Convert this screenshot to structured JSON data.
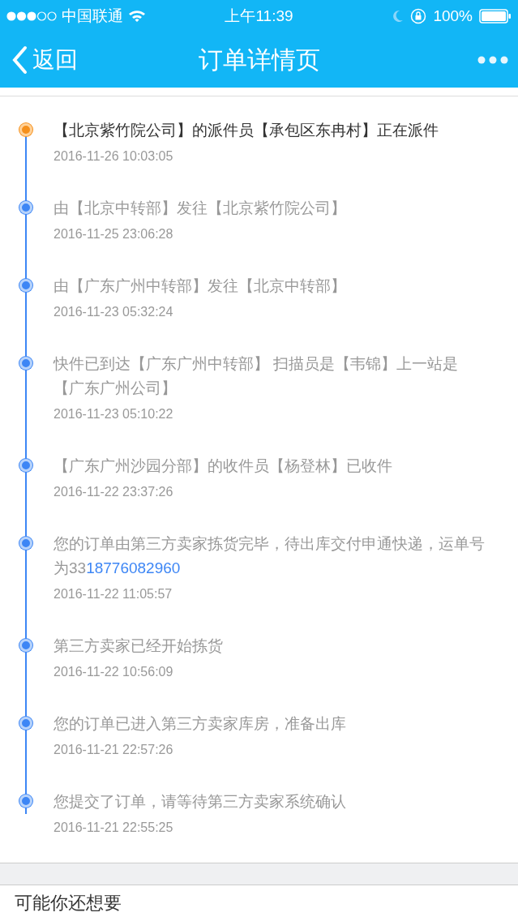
{
  "status_bar": {
    "carrier": "中国联通",
    "time": "上午11:39",
    "battery": "100%"
  },
  "nav": {
    "back": "返回",
    "title": "订单详情页"
  },
  "tracking": [
    {
      "text": "【北京紫竹院公司】的派件员【承包区东冉村】正在派件",
      "time": "2016-11-26 10:03:05",
      "current": true
    },
    {
      "text": "由【北京中转部】发往【北京紫竹院公司】",
      "time": "2016-11-25 23:06:28",
      "current": false
    },
    {
      "text": "由【广东广州中转部】发往【北京中转部】",
      "time": "2016-11-23 05:32:24",
      "current": false
    },
    {
      "text": "快件已到达【广东广州中转部】 扫描员是【韦锦】上一站是【广东广州公司】",
      "time": "2016-11-23 05:10:22",
      "current": false
    },
    {
      "text": "【广东广州沙园分部】的收件员【杨登林】已收件",
      "time": "2016-11-22 23:37:26",
      "current": false
    },
    {
      "text": "您的订单由第三方卖家拣货完毕，待出库交付申通快递，运单号为33",
      "link": "18776082960",
      "time": "2016-11-22 11:05:57",
      "current": false
    },
    {
      "text": "第三方卖家已经开始拣货",
      "time": "2016-11-22 10:56:09",
      "current": false
    },
    {
      "text": "您的订单已进入第三方卖家库房，准备出库",
      "time": "2016-11-21 22:57:26",
      "current": false
    },
    {
      "text": "您提交了订单，请等待第三方卖家系统确认",
      "time": "2016-11-21 22:55:25",
      "current": false
    }
  ],
  "recommend": {
    "title": "可能你还想要"
  }
}
